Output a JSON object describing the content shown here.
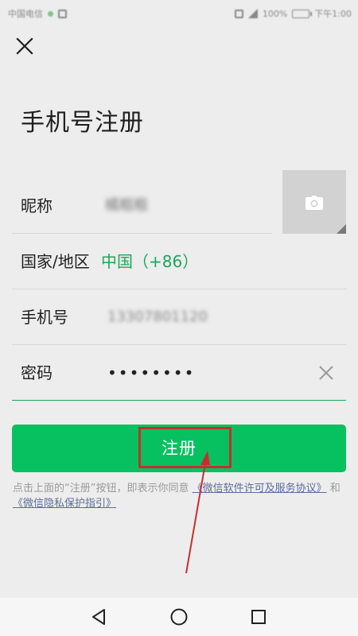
{
  "status_bar": {
    "carrier": "中国电信",
    "battery": "100%",
    "time": "下午1:00"
  },
  "header": {
    "title": "手机号注册"
  },
  "form": {
    "nickname": {
      "label": "昵称",
      "value": "橘粗粗"
    },
    "region": {
      "label": "国家/地区",
      "value": "中国（+86）"
    },
    "phone": {
      "label": "手机号",
      "value": "13307801120"
    },
    "password": {
      "label": "密码",
      "value": "••••••••"
    }
  },
  "register": {
    "label": "注册"
  },
  "agreement": {
    "prefix": "点击上面的“注册”按钮，即表示你同意",
    "link1": "《微信软件许可及服务协议》",
    "middle": "和",
    "link2": "《微信隐私保护指引》"
  },
  "colors": {
    "accent": "#07c160",
    "link": "#5b6f97",
    "annotation": "#c62f2f",
    "background": "#ededed"
  }
}
